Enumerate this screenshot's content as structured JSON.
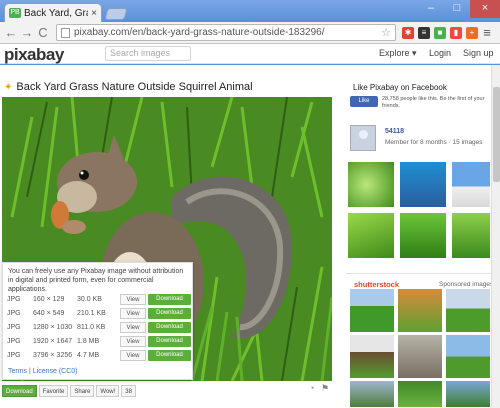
{
  "browser": {
    "tab_title": "Back Yard, Grass, Nature,",
    "tab_favicon": "PB",
    "tab_close": "×",
    "url": "pixabay.com/en/back-yard-grass-nature-outside-183296/",
    "win_min": "–",
    "win_max": "□",
    "win_close": "×",
    "back_glyph": "←",
    "forward_glyph": "→",
    "reload_glyph": "C",
    "menu_glyph": "≡"
  },
  "header": {
    "logo": "pixabay",
    "search_placeholder": "Search images",
    "nav": {
      "explore": "Explore ▾",
      "login": "Login",
      "signup": "Sign up"
    }
  },
  "page": {
    "title": "Back Yard Grass Nature Outside Squirrel Animal",
    "info_text": "You can freely use any Pixabay image without attribution in digital and printed form, even for commercial applications.",
    "sizes": [
      {
        "fmt": "JPG",
        "dims": "160 × 129",
        "size": "30.0 KB"
      },
      {
        "fmt": "JPG",
        "dims": "640 × 549",
        "size": "210.1 KB"
      },
      {
        "fmt": "JPG",
        "dims": "1280 × 1030",
        "size": "811.0 KB"
      },
      {
        "fmt": "JPG",
        "dims": "1920 × 1647",
        "size": "1.8 MB"
      },
      {
        "fmt": "JPG",
        "dims": "3796 × 3256",
        "size": "4.7 MB"
      }
    ],
    "view_label": "View",
    "download_label": "Download",
    "terms": "Terms  |  License (CC0)",
    "actions": {
      "download": "Download",
      "favorite": "Favorite",
      "share": "Share",
      "wow": "Wow!",
      "count": "38"
    }
  },
  "sidebar": {
    "fb_title": "Like Pixabay on Facebook",
    "fb_like": "Like",
    "fb_text": "28,758 people like this. Be the first of your friends.",
    "user_name": "54118",
    "user_meta": "Member for 8 months · 15 images",
    "stock_logo": "shutterstock",
    "sponsored": "Sponsored images"
  },
  "colors": {
    "download_green": "#5cae3b",
    "link_blue": "#3a76c4",
    "shutter_red": "#e73f2c"
  }
}
